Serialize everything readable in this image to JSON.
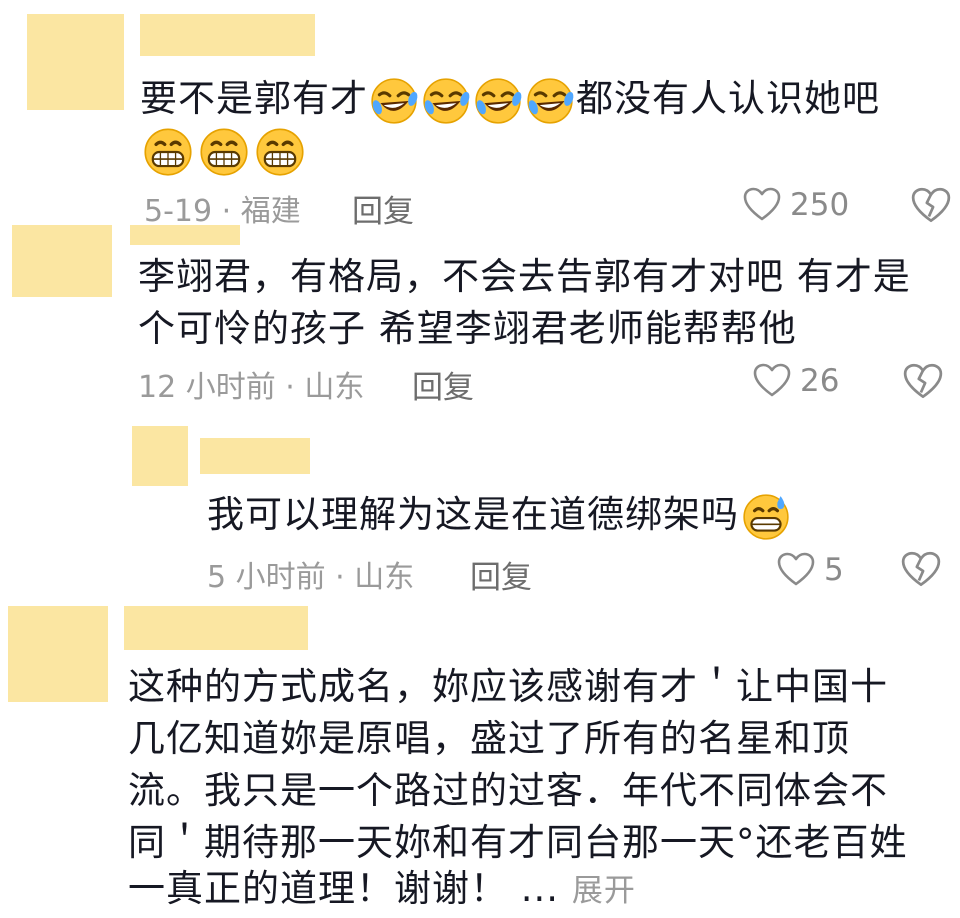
{
  "comments": [
    {
      "text_line1": "要不是郭有才",
      "text_line1_after": "都没有人认识她吧",
      "meta": "5-19 · 福建",
      "reply": "回复",
      "likes": "250"
    },
    {
      "text_line1": "李翊君，有格局，不会去告郭有才对吧 有才是",
      "text_line2": "个可怜的孩子 希望李翊君老师能帮帮他",
      "meta": "12 小时前 · 山东",
      "reply": "回复",
      "likes": "26"
    },
    {
      "text_line1": "我可以理解为这是在道德绑架吗",
      "meta": "5 小时前 · 山东",
      "reply": "回复",
      "likes": "5"
    },
    {
      "lines": [
        "这种的方式成名，妳应该感谢有才＇让中国十",
        "几亿知道妳是原唱，盛过了所有的名星和顶",
        "流。我只是一个路过的过客．年代不同体会不",
        "同＇期待那一天妳和有才同台那一天°还老百姓",
        "一真正的道理！谢谢！"
      ],
      "ellipsis": "...",
      "expand": "展开"
    }
  ],
  "colors": {
    "avatar_placeholder": "#fbe6a2",
    "text": "#161823",
    "meta": "#9a9a9a"
  },
  "icons": [
    "rofl-emoji",
    "grin-emoji",
    "sweat-grin-emoji",
    "heart-outline-icon",
    "broken-heart-icon"
  ]
}
